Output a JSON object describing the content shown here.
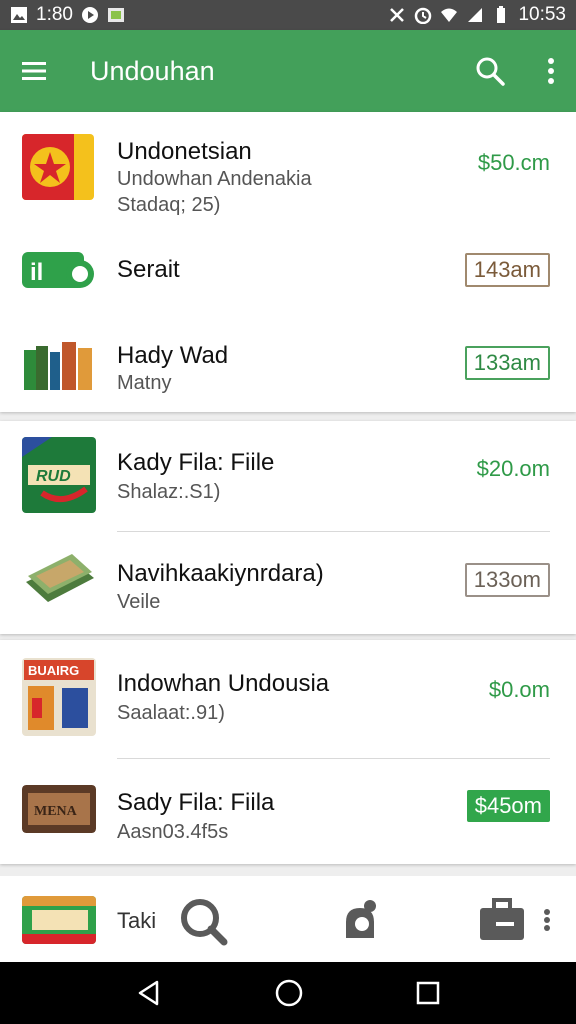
{
  "status_bar": {
    "time_left": "1:80",
    "time_right": "10:53"
  },
  "app_bar": {
    "title": "Undouhan"
  },
  "items": [
    {
      "title": "Undonetsian",
      "subtitle": "Undowhan Andenakia",
      "subtitle2": "Stadaq; 25)",
      "price": "$50.cm",
      "thumb": "flag-thumb"
    },
    {
      "title": "Serait",
      "price": "143am",
      "thumb": "ilo-logo"
    },
    {
      "title": "Hady Wad",
      "subtitle": "Matny",
      "price": "133am",
      "thumb": "books-thumb"
    },
    {
      "title": "Kady Fila: Fiile",
      "subtitle": "Shalaz:.S1)",
      "price": "$20.om",
      "thumb": "rudi-thumb"
    },
    {
      "title": "Navihkaakiynrdara)",
      "subtitle": "Veile",
      "price": "133om",
      "thumb": "banknotes-thumb"
    },
    {
      "title": "Indowhan Undousia",
      "subtitle": "Saalaat:.91)",
      "price": "$0.om",
      "thumb": "poster-thumb"
    },
    {
      "title": "Sady Fila: Fiila",
      "subtitle": "Aasn03.4f5s",
      "price": "$45om",
      "thumb": "box-thumb"
    }
  ],
  "bottom": {
    "label": "Taki"
  },
  "colors": {
    "primary": "#43a05a",
    "price_green": "#2f9a48"
  }
}
